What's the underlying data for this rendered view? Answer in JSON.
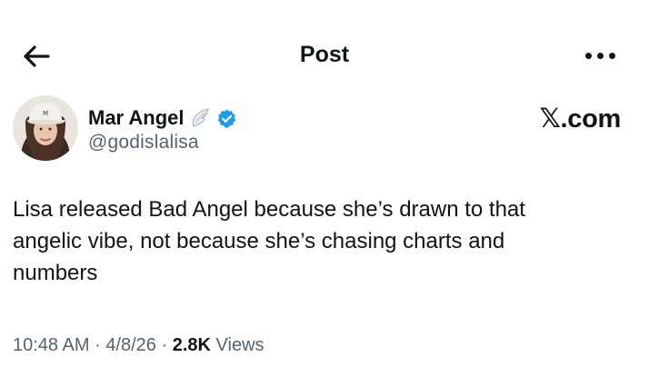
{
  "header": {
    "title": "Post",
    "back_icon": "arrow-left-icon",
    "more_icon": "more-horizontal-icon"
  },
  "author": {
    "name": "Mar Angel",
    "handle": "@godislalisa",
    "name_emoji": "angel-wing-icon",
    "verified": true,
    "verified_color": "#1d9bf0"
  },
  "watermark": {
    "text": "𝕏.com"
  },
  "post": {
    "text_lines": [
      "Lisa released Bad Angel because she’s drawn to that",
      "angelic vibe, not because she’s chasing charts and",
      "numbers"
    ]
  },
  "meta": {
    "time": "10:48 AM",
    "separator": "·",
    "date": "4/8/26",
    "views_count": "2.8K",
    "views_label": "Views"
  },
  "colors": {
    "text": "#0f1419",
    "secondary": "#536471",
    "background": "#ffffff"
  }
}
